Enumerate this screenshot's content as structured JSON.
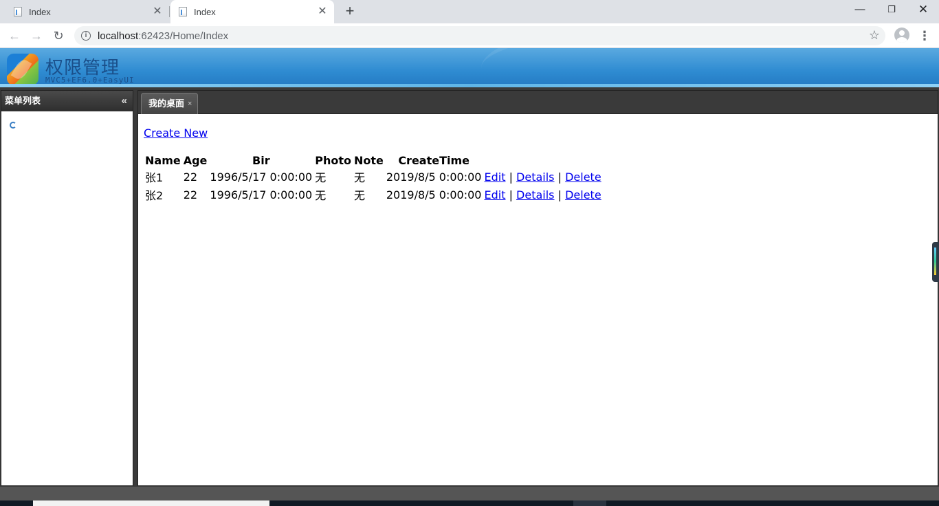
{
  "browser": {
    "tabs": [
      {
        "title": "Index",
        "active": false
      },
      {
        "title": "Index",
        "active": true
      }
    ],
    "new_tab_symbol": "+",
    "window_controls": {
      "minimize": "—",
      "maximize": "❐",
      "close": "✕"
    },
    "address": {
      "host": "localhost",
      "rest": ":62423/Home/Index"
    },
    "icons": [
      "back-arrow-icon",
      "forward-arrow-icon",
      "reload-icon",
      "info-icon",
      "star-icon",
      "avatar-icon",
      "menu-icon"
    ]
  },
  "app": {
    "title": "权限管理",
    "subtitle": "MVC5+EF6.0+EasyUI"
  },
  "sidebar": {
    "title": "菜单列表"
  },
  "main": {
    "tab_label": "我的桌面",
    "create_link": "Create New",
    "table": {
      "columns": [
        "Name",
        "Age",
        "Bir",
        "Photo",
        "Note",
        "CreateTime",
        ""
      ],
      "rows": [
        {
          "name": "张1",
          "age": "22",
          "bir": "1996/5/17 0:00:00",
          "photo": "无",
          "note": "无",
          "createtime": "2019/8/5 0:00:00"
        },
        {
          "name": "张2",
          "age": "22",
          "bir": "1996/5/17 0:00:00",
          "photo": "无",
          "note": "无",
          "createtime": "2019/8/5 0:00:00"
        }
      ],
      "actions": {
        "edit": "Edit",
        "details": "Details",
        "delete": "Delete",
        "separator": "|"
      }
    }
  },
  "colors": {
    "header_blue": "#2e8bd1",
    "panel_dark": "#3a3a3a",
    "link": "#0000ee"
  }
}
